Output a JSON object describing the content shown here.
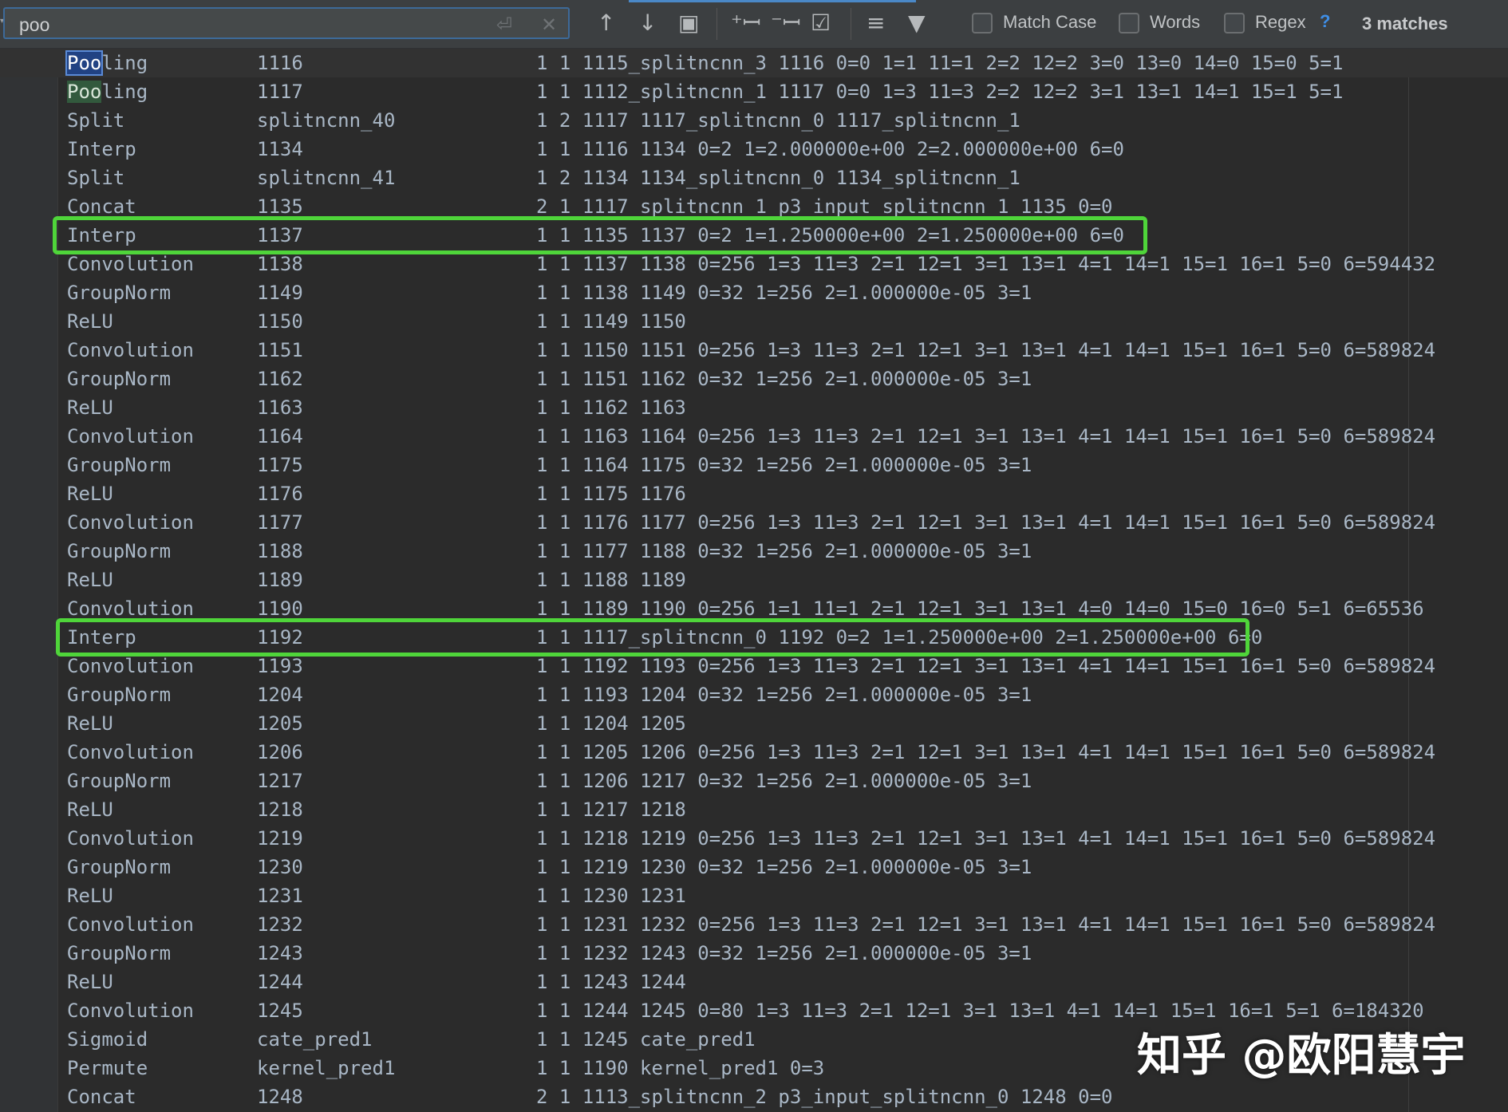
{
  "find": {
    "query": "poo",
    "match_case_label": "Match Case",
    "words_label": "Words",
    "regex_label": "Regex",
    "help_label": "?",
    "matches_label": "3 matches"
  },
  "icons": [
    "replace-newline-icon",
    "clear-icon",
    "arrow-up-icon",
    "arrow-down-icon",
    "select-all-icon",
    "add-occurrence-icon",
    "remove-occurrence-icon",
    "select-occurrences-icon",
    "filter-lines-icon",
    "funnel-icon"
  ],
  "lines": [
    {
      "name": "Pooling",
      "id": "1116",
      "args": "1 1 1115_splitncnn_3 1116 0=0 1=1 11=1 2=2 12=2 3=0 13=0 14=0 15=0 5=1",
      "match": "Poo",
      "rest": "ling",
      "match_state": "current"
    },
    {
      "name": "Pooling",
      "id": "1117",
      "args": "1 1 1112_splitncnn_1 1117 0=0 1=3 11=3 2=2 12=2 3=1 13=1 14=1 15=1 5=1",
      "match": "Poo",
      "rest": "ling",
      "match_state": "other"
    },
    {
      "name": "Split",
      "id": "splitncnn_40",
      "args": "1 2 1117 1117_splitncnn_0 1117_splitncnn_1"
    },
    {
      "name": "Interp",
      "id": "1134",
      "args": "1 1 1116 1134 0=2 1=2.000000e+00 2=2.000000e+00 6=0"
    },
    {
      "name": "Split",
      "id": "splitncnn_41",
      "args": "1 2 1134 1134_splitncnn_0 1134_splitncnn_1"
    },
    {
      "name": "Concat",
      "id": "1135",
      "args": "2 1 1117_splitncnn_1 p3_input_splitncnn_1 1135 0=0"
    },
    {
      "name": "Interp",
      "id": "1137",
      "args": "1 1 1135 1137 0=2 1=1.250000e+00 2=1.250000e+00 6=0"
    },
    {
      "name": "Convolution",
      "id": "1138",
      "args": "1 1 1137 1138 0=256 1=3 11=3 2=1 12=1 3=1 13=1 4=1 14=1 15=1 16=1 5=0 6=594432"
    },
    {
      "name": "GroupNorm",
      "id": "1149",
      "args": "1 1 1138 1149 0=32 1=256 2=1.000000e-05 3=1"
    },
    {
      "name": "ReLU",
      "id": "1150",
      "args": "1 1 1149 1150"
    },
    {
      "name": "Convolution",
      "id": "1151",
      "args": "1 1 1150 1151 0=256 1=3 11=3 2=1 12=1 3=1 13=1 4=1 14=1 15=1 16=1 5=0 6=589824"
    },
    {
      "name": "GroupNorm",
      "id": "1162",
      "args": "1 1 1151 1162 0=32 1=256 2=1.000000e-05 3=1"
    },
    {
      "name": "ReLU",
      "id": "1163",
      "args": "1 1 1162 1163"
    },
    {
      "name": "Convolution",
      "id": "1164",
      "args": "1 1 1163 1164 0=256 1=3 11=3 2=1 12=1 3=1 13=1 4=1 14=1 15=1 16=1 5=0 6=589824"
    },
    {
      "name": "GroupNorm",
      "id": "1175",
      "args": "1 1 1164 1175 0=32 1=256 2=1.000000e-05 3=1"
    },
    {
      "name": "ReLU",
      "id": "1176",
      "args": "1 1 1175 1176"
    },
    {
      "name": "Convolution",
      "id": "1177",
      "args": "1 1 1176 1177 0=256 1=3 11=3 2=1 12=1 3=1 13=1 4=1 14=1 15=1 16=1 5=0 6=589824"
    },
    {
      "name": "GroupNorm",
      "id": "1188",
      "args": "1 1 1177 1188 0=32 1=256 2=1.000000e-05 3=1"
    },
    {
      "name": "ReLU",
      "id": "1189",
      "args": "1 1 1188 1189"
    },
    {
      "name": "Convolution",
      "id": "1190",
      "args": "1 1 1189 1190 0=256 1=1 11=1 2=1 12=1 3=1 13=1 4=0 14=0 15=0 16=0 5=1 6=65536"
    },
    {
      "name": "Interp",
      "id": "1192",
      "args": "1 1 1117_splitncnn_0 1192 0=2 1=1.250000e+00 2=1.250000e+00 6=0"
    },
    {
      "name": "Convolution",
      "id": "1193",
      "args": "1 1 1192 1193 0=256 1=3 11=3 2=1 12=1 3=1 13=1 4=1 14=1 15=1 16=1 5=0 6=589824"
    },
    {
      "name": "GroupNorm",
      "id": "1204",
      "args": "1 1 1193 1204 0=32 1=256 2=1.000000e-05 3=1"
    },
    {
      "name": "ReLU",
      "id": "1205",
      "args": "1 1 1204 1205"
    },
    {
      "name": "Convolution",
      "id": "1206",
      "args": "1 1 1205 1206 0=256 1=3 11=3 2=1 12=1 3=1 13=1 4=1 14=1 15=1 16=1 5=0 6=589824"
    },
    {
      "name": "GroupNorm",
      "id": "1217",
      "args": "1 1 1206 1217 0=32 1=256 2=1.000000e-05 3=1"
    },
    {
      "name": "ReLU",
      "id": "1218",
      "args": "1 1 1217 1218"
    },
    {
      "name": "Convolution",
      "id": "1219",
      "args": "1 1 1218 1219 0=256 1=3 11=3 2=1 12=1 3=1 13=1 4=1 14=1 15=1 16=1 5=0 6=589824"
    },
    {
      "name": "GroupNorm",
      "id": "1230",
      "args": "1 1 1219 1230 0=32 1=256 2=1.000000e-05 3=1"
    },
    {
      "name": "ReLU",
      "id": "1231",
      "args": "1 1 1230 1231"
    },
    {
      "name": "Convolution",
      "id": "1232",
      "args": "1 1 1231 1232 0=256 1=3 11=3 2=1 12=1 3=1 13=1 4=1 14=1 15=1 16=1 5=0 6=589824"
    },
    {
      "name": "GroupNorm",
      "id": "1243",
      "args": "1 1 1232 1243 0=32 1=256 2=1.000000e-05 3=1"
    },
    {
      "name": "ReLU",
      "id": "1244",
      "args": "1 1 1243 1244"
    },
    {
      "name": "Convolution",
      "id": "1245",
      "args": "1 1 1244 1245 0=80 1=3 11=3 2=1 12=1 3=1 13=1 4=1 14=1 15=1 16=1 5=1 6=184320"
    },
    {
      "name": "Sigmoid",
      "id": "cate_pred1",
      "args": "1 1 1245 cate_pred1"
    },
    {
      "name": "Permute",
      "id": "kernel_pred1",
      "args": "1 1 1190 kernel_pred1 0=3"
    },
    {
      "name": "Concat",
      "id": "1248",
      "args": "2 1 1113_splitncnn_2 p3_input_splitncnn_0 1248 0=0"
    }
  ],
  "highlighted_rows": [
    6,
    20
  ],
  "highlight_color": "#4fd53a",
  "watermark": "知乎 @欧阳慧宇"
}
